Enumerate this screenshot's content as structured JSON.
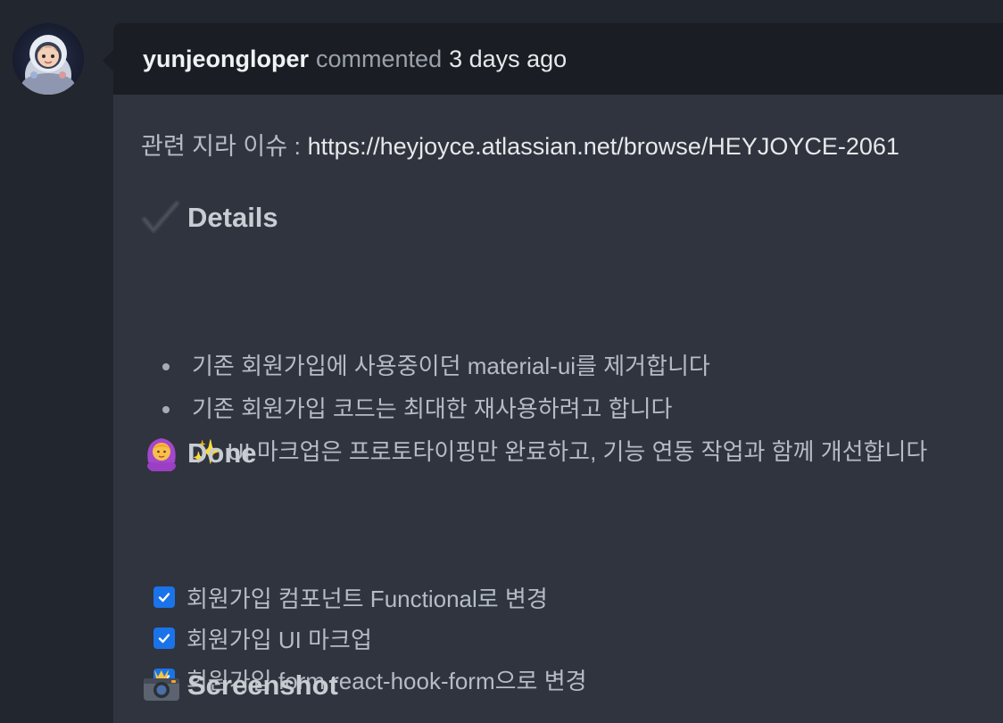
{
  "comment": {
    "author": "yunjeongloper",
    "action": "commented",
    "time": "3 days ago"
  },
  "body": {
    "jira_prefix": "관련 지라 이슈 : ",
    "jira_link": "https://heyjoyce.atlassian.net/browse/HEYJOYCE-2061",
    "details": {
      "icon": "heavy-check-mark-icon",
      "title": "Details",
      "items": [
        "기존 회원가입에 사용중이던 material-ui를 제거합니다",
        "기존 회원가입 코드는 최대한 재사용하려고 합니다",
        "✨ UI 마크업은 프로토타이핑만 완료하고, 기능 연동 작업과 함께 개선합니다"
      ]
    },
    "done": {
      "icon": "person-gesturing-ok-icon",
      "title": "Done",
      "tasks": [
        {
          "label": "회원가입 컴포넌트 Functional로 변경",
          "checked": true
        },
        {
          "label": "회원가입 UI 마크업",
          "checked": true
        },
        {
          "label": "회원가입 form react-hook-form으로 변경",
          "checked": true
        }
      ]
    },
    "screenshot": {
      "icon": "camera-with-flash-icon",
      "title": "Screenshot"
    }
  },
  "colors": {
    "page_bg": "#22262e",
    "header_bg": "#1a1d23",
    "body_bg": "#2f343e",
    "checkbox": "#1a73e8"
  }
}
